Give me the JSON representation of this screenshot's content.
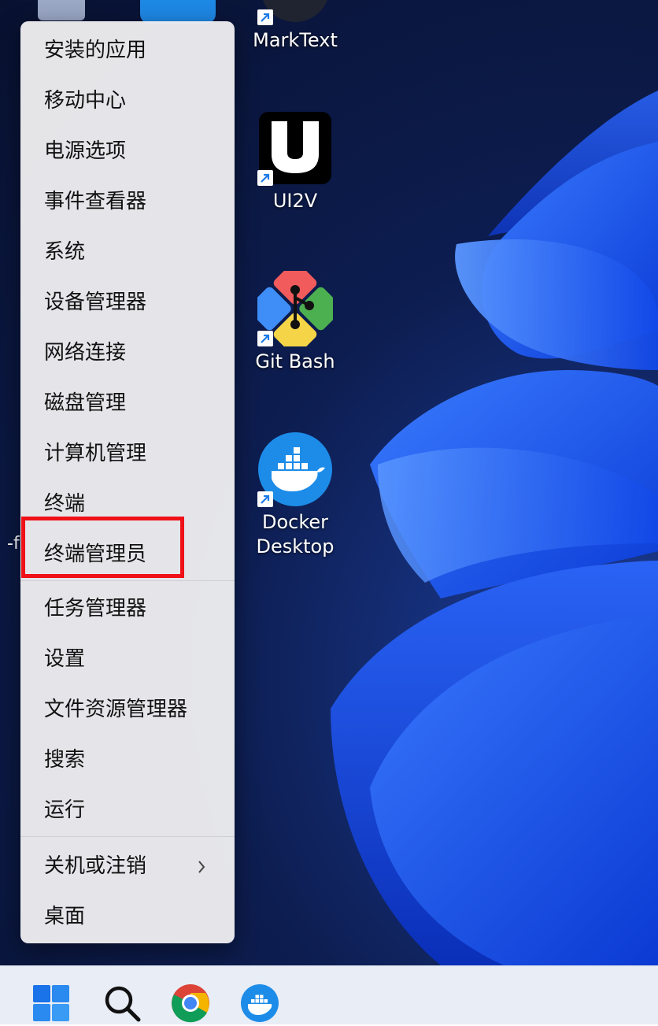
{
  "desktop": {
    "icons": [
      {
        "name": "marktext",
        "label": "MarkText"
      },
      {
        "name": "ui2v",
        "label": "UI2V"
      },
      {
        "name": "git-bash",
        "label": "Git Bash"
      },
      {
        "name": "docker-desktop",
        "label": "Docker\nDesktop"
      }
    ],
    "edge_text": "-f"
  },
  "context_menu": {
    "items": [
      {
        "label": "安装的应用"
      },
      {
        "label": "移动中心"
      },
      {
        "label": "电源选项"
      },
      {
        "label": "事件查看器"
      },
      {
        "label": "系统"
      },
      {
        "label": "设备管理器"
      },
      {
        "label": "网络连接"
      },
      {
        "label": "磁盘管理"
      },
      {
        "label": "计算机管理"
      },
      {
        "label": "终端"
      },
      {
        "label": "终端管理员",
        "highlighted": true
      },
      {
        "label": "任务管理器"
      },
      {
        "label": "设置"
      },
      {
        "label": "文件资源管理器"
      },
      {
        "label": "搜索"
      },
      {
        "label": "运行"
      },
      {
        "label": "关机或注销",
        "has_submenu": true
      },
      {
        "label": "桌面"
      }
    ],
    "highlight_color": "#f01018"
  },
  "taskbar": {
    "icons": [
      "windows-start-icon",
      "search-icon",
      "chrome-icon",
      "docker-icon"
    ]
  },
  "colors": {
    "accent": "#1f6feb",
    "menu_bg": "#ececee",
    "taskbar_bg": "#e8edf6"
  }
}
